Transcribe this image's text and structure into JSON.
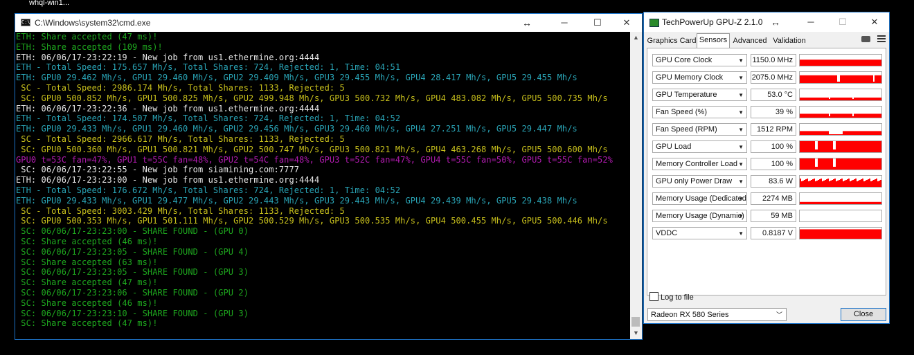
{
  "taskbar": {
    "label": "whql-win1..."
  },
  "cmd": {
    "title": "C:\\Windows\\system32\\cmd.exe",
    "icon": "cmd-icon",
    "controls": {
      "minimize": "─",
      "maximize": "☐",
      "close": "✕"
    },
    "lines": [
      {
        "text": "ETH: Share accepted (47 ms)!",
        "color": "#1ea81e"
      },
      {
        "text": "ETH: Share accepted (109 ms)!",
        "color": "#1ea81e"
      },
      {
        "text": "ETH: 06/06/17-23:22:19 - New job from us1.ethermine.org:4444",
        "color": "#e8e8e8"
      },
      {
        "text": "ETH - Total Speed: 175.657 Mh/s, Total Shares: 724, Rejected: 1, Time: 04:51",
        "color": "#2aa6b8"
      },
      {
        "text": "ETH: GPU0 29.462 Mh/s, GPU1 29.460 Mh/s, GPU2 29.409 Mh/s, GPU3 29.455 Mh/s, GPU4 28.417 Mh/s, GPU5 29.455 Mh/s",
        "color": "#2aa6b8"
      },
      {
        "text": " SC - Total Speed: 2986.174 Mh/s, Total Shares: 1133, Rejected: 5",
        "color": "#c8c01c"
      },
      {
        "text": " SC: GPU0 500.852 Mh/s, GPU1 500.825 Mh/s, GPU2 499.948 Mh/s, GPU3 500.732 Mh/s, GPU4 483.082 Mh/s, GPU5 500.735 Mh/s",
        "color": "#c8c01c"
      },
      {
        "text": "ETH: 06/06/17-23:22:36 - New job from us1.ethermine.org:4444",
        "color": "#e8e8e8"
      },
      {
        "text": "ETH - Total Speed: 174.507 Mh/s, Total Shares: 724, Rejected: 1, Time: 04:52",
        "color": "#2aa6b8"
      },
      {
        "text": "ETH: GPU0 29.433 Mh/s, GPU1 29.460 Mh/s, GPU2 29.456 Mh/s, GPU3 29.460 Mh/s, GPU4 27.251 Mh/s, GPU5 29.447 Mh/s",
        "color": "#2aa6b8"
      },
      {
        "text": " SC - Total Speed: 2966.617 Mh/s, Total Shares: 1133, Rejected: 5",
        "color": "#c8c01c"
      },
      {
        "text": " SC: GPU0 500.360 Mh/s, GPU1 500.821 Mh/s, GPU2 500.747 Mh/s, GPU3 500.821 Mh/s, GPU4 463.268 Mh/s, GPU5 500.600 Mh/s",
        "color": "#c8c01c"
      },
      {
        "text": "GPU0 t=53C fan=47%, GPU1 t=55C fan=48%, GPU2 t=54C fan=48%, GPU3 t=52C fan=47%, GPU4 t=55C fan=50%, GPU5 t=55C fan=52%",
        "color": "#b21bb0"
      },
      {
        "text": " SC: 06/06/17-23:22:55 - New job from siamining.com:7777",
        "color": "#e8e8e8"
      },
      {
        "text": "ETH: 06/06/17-23:23:00 - New job from us1.ethermine.org:4444",
        "color": "#e8e8e8"
      },
      {
        "text": "ETH - Total Speed: 176.672 Mh/s, Total Shares: 724, Rejected: 1, Time: 04:52",
        "color": "#2aa6b8"
      },
      {
        "text": "ETH: GPU0 29.433 Mh/s, GPU1 29.477 Mh/s, GPU2 29.443 Mh/s, GPU3 29.443 Mh/s, GPU4 29.439 Mh/s, GPU5 29.438 Mh/s",
        "color": "#2aa6b8"
      },
      {
        "text": " SC - Total Speed: 3003.429 Mh/s, Total Shares: 1133, Rejected: 5",
        "color": "#c8c01c"
      },
      {
        "text": " SC: GPU0 500.353 Mh/s, GPU1 501.111 Mh/s, GPU2 500.529 Mh/s, GPU3 500.535 Mh/s, GPU4 500.455 Mh/s, GPU5 500.446 Mh/s",
        "color": "#c8c01c"
      },
      {
        "text": " SC: 06/06/17-23:23:00 - SHARE FOUND - (GPU 0)",
        "color": "#1ea81e"
      },
      {
        "text": " SC: Share accepted (46 ms)!",
        "color": "#1ea81e"
      },
      {
        "text": " SC: 06/06/17-23:23:05 - SHARE FOUND - (GPU 4)",
        "color": "#1ea81e"
      },
      {
        "text": " SC: Share accepted (63 ms)!",
        "color": "#1ea81e"
      },
      {
        "text": " SC: 06/06/17-23:23:05 - SHARE FOUND - (GPU 3)",
        "color": "#1ea81e"
      },
      {
        "text": " SC: Share accepted (47 ms)!",
        "color": "#1ea81e"
      },
      {
        "text": " SC: 06/06/17-23:23:06 - SHARE FOUND - (GPU 2)",
        "color": "#1ea81e"
      },
      {
        "text": " SC: Share accepted (46 ms)!",
        "color": "#1ea81e"
      },
      {
        "text": " SC: 06/06/17-23:23:10 - SHARE FOUND - (GPU 3)",
        "color": "#1ea81e"
      },
      {
        "text": " SC: Share accepted (47 ms)!",
        "color": "#1ea81e"
      }
    ]
  },
  "gpuz": {
    "title": "TechPowerUp GPU-Z 2.1.0",
    "controls": {
      "minimize": "─",
      "maximize": "☐",
      "close": "✕"
    },
    "tabs": [
      {
        "label": "Graphics Card"
      },
      {
        "label": "Sensors",
        "active": true
      },
      {
        "label": "Advanced"
      },
      {
        "label": "Validation"
      }
    ],
    "graph_color": "#ff0000",
    "sensors": [
      {
        "name": "GPU Core Clock",
        "value": "1150.0 MHz",
        "level": 0.55,
        "pattern": "solid"
      },
      {
        "name": "GPU Memory Clock",
        "value": "2075.0 MHz",
        "level": 0.7,
        "pattern": "gappy"
      },
      {
        "name": "GPU Temperature",
        "value": "53.0 °C",
        "level": 0.25,
        "pattern": "low"
      },
      {
        "name": "Fan Speed (%)",
        "value": "39 %",
        "level": 0.35,
        "pattern": "low"
      },
      {
        "name": "Fan Speed (RPM)",
        "value": "1512 RPM",
        "level": 0.35,
        "pattern": "dip"
      },
      {
        "name": "GPU Load",
        "value": "100 %",
        "level": 1.0,
        "pattern": "spiky"
      },
      {
        "name": "Memory Controller Load",
        "value": "100 %",
        "level": 1.0,
        "pattern": "spiky"
      },
      {
        "name": "GPU only Power Draw",
        "value": "83.6 W",
        "level": 0.75,
        "pattern": "jagged"
      },
      {
        "name": "Memory Usage (Dedicated)",
        "value": "2274 MB",
        "level": 0.2,
        "pattern": "flat"
      },
      {
        "name": "Memory Usage (Dynamic)",
        "value": "59 MB",
        "level": 0.0,
        "pattern": "empty"
      },
      {
        "name": "VDDC",
        "value": "0.8187 V",
        "level": 0.85,
        "pattern": "solid"
      }
    ],
    "log_to_file": "Log to file",
    "gpu_select": "Radeon RX 580 Series",
    "close_button": "Close"
  }
}
